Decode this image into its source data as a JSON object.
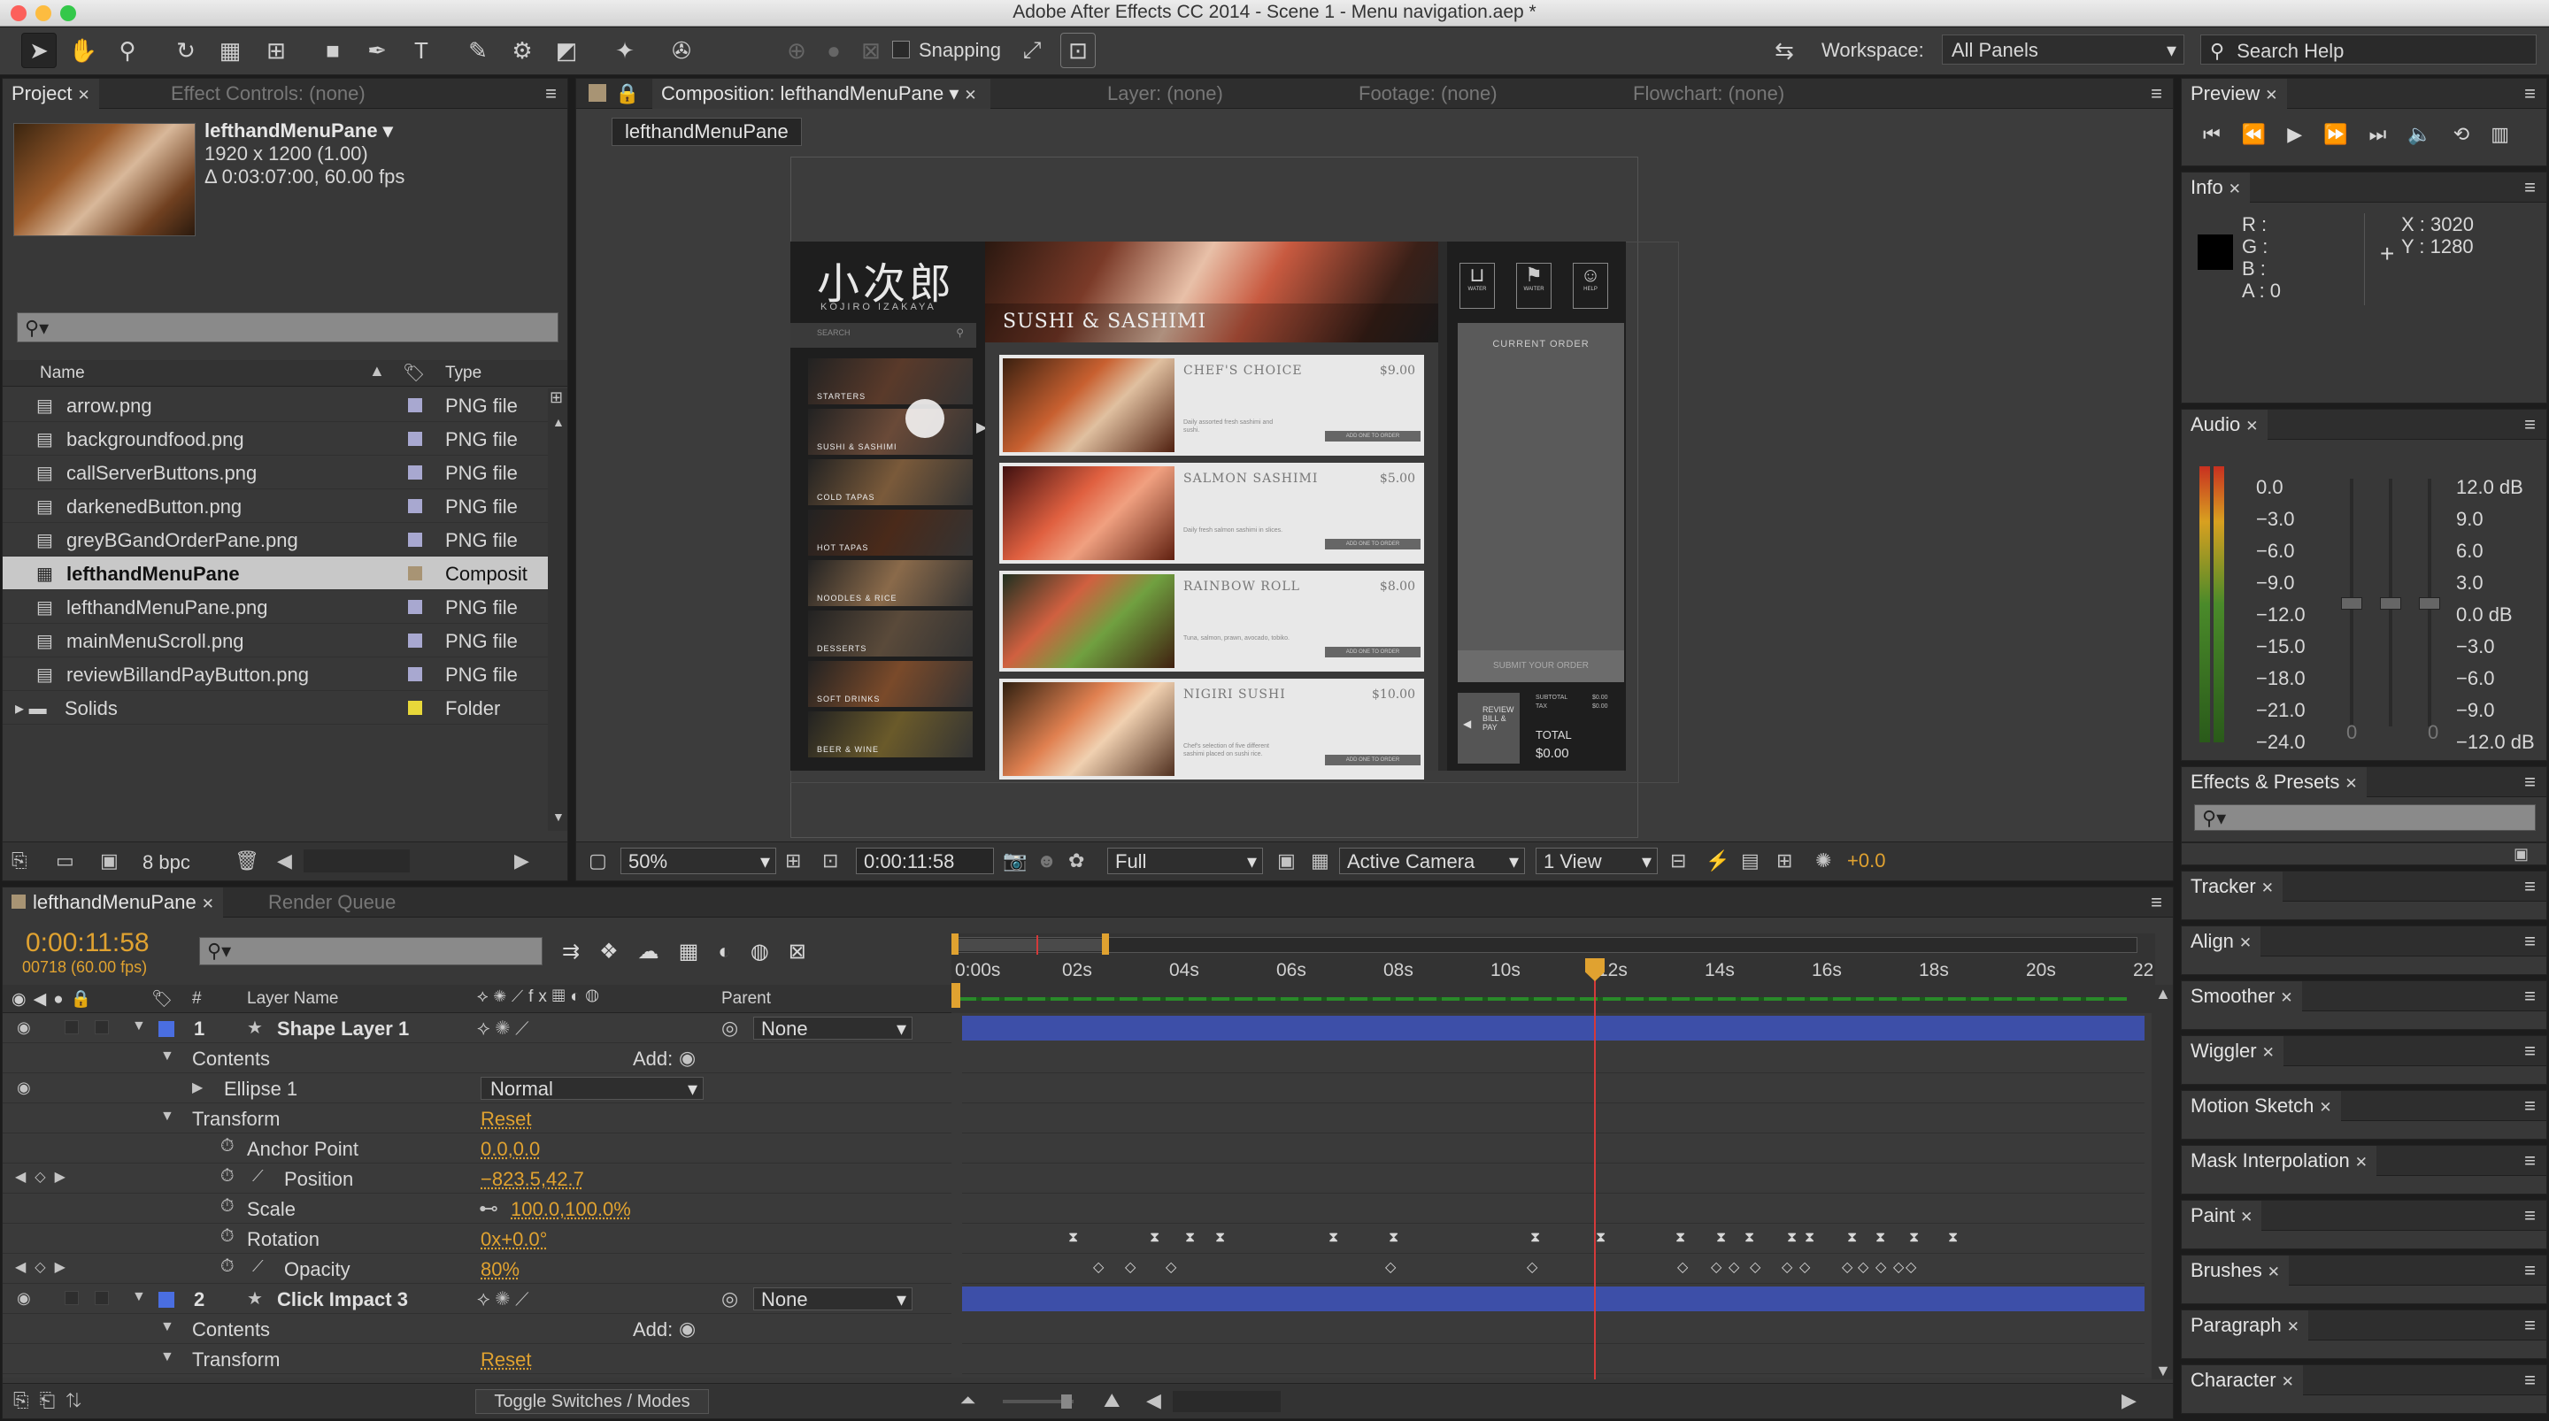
{
  "window": {
    "title": "Adobe After Effects CC 2014 - Scene 1 - Menu navigation.aep *"
  },
  "toolbar": {
    "snapping_label": "Snapping",
    "workspace_label": "Workspace:",
    "workspace_value": "All Panels",
    "search_help": "Search Help"
  },
  "project": {
    "tab": "Project",
    "effect_controls_tab": "Effect Controls: (none)",
    "item_name": "lefthandMenuPane",
    "item_size": "1920 x 1200 (1.00)",
    "item_duration": "Δ 0:03:07:00, 60.00 fps",
    "col_name": "Name",
    "col_type": "Type",
    "files": [
      {
        "name": "arrow.png",
        "type": "PNG file",
        "color": "#a8a8d0"
      },
      {
        "name": "backgroundfood.png",
        "type": "PNG file",
        "color": "#a8a8d0"
      },
      {
        "name": "callServerButtons.png",
        "type": "PNG file",
        "color": "#a8a8d0"
      },
      {
        "name": "darkenedButton.png",
        "type": "PNG file",
        "color": "#a8a8d0"
      },
      {
        "name": "greyBGandOrderPane.png",
        "type": "PNG file",
        "color": "#a8a8d0"
      },
      {
        "name": "lefthandMenuPane",
        "type": "Composit",
        "color": "#a89474"
      },
      {
        "name": "lefthandMenuPane.png",
        "type": "PNG file",
        "color": "#a8a8d0"
      },
      {
        "name": "mainMenuScroll.png",
        "type": "PNG file",
        "color": "#a8a8d0"
      },
      {
        "name": "reviewBillandPayButton.png",
        "type": "PNG file",
        "color": "#a8a8d0"
      },
      {
        "name": "Solids",
        "type": "Folder",
        "color": "#e8d83a"
      }
    ],
    "bpc": "8 bpc"
  },
  "composition": {
    "tab": "Composition: lefthandMenuPane",
    "other_tabs": [
      "Layer: (none)",
      "Footage: (none)",
      "Flowchart: (none)"
    ],
    "breadcrumb": "lefthandMenuPane",
    "zoom": "50%",
    "timecode": "0:00:11:58",
    "resolution": "Full",
    "camera": "Active Camera",
    "view": "1 View",
    "exposure": "+0.0"
  },
  "mock": {
    "logo": "小次郎",
    "logo_sub": "KOJIRO IZAKAYA",
    "search": "SEARCH",
    "header": "SUSHI & SASHIMI",
    "categories": [
      "STARTERS",
      "SUSHI & SASHIMI",
      "COLD TAPAS",
      "HOT TAPAS",
      "NOODLES & RICE",
      "DESSERTS",
      "SOFT DRINKS",
      "BEER & WINE"
    ],
    "items": [
      {
        "name": "CHEF'S CHOICE",
        "price": "$9.00",
        "desc": "Daily assorted fresh sashimi and sushi.",
        "btn": "ADD ONE TO ORDER"
      },
      {
        "name": "SALMON SASHIMI",
        "price": "$5.00",
        "desc": "Daily fresh salmon sashimi in slices.",
        "btn": "ADD ONE TO ORDER"
      },
      {
        "name": "RAINBOW ROLL",
        "price": "$8.00",
        "desc": "Tuna, salmon, prawn, avocado, tobiko.",
        "btn": "ADD ONE TO ORDER"
      },
      {
        "name": "NIGIRI SUSHI",
        "price": "$10.00",
        "desc": "Chef's selection of five different sashimi placed on sushi rice.",
        "btn": "ADD ONE TO ORDER"
      }
    ],
    "current_order": "CURRENT ORDER",
    "submit": "SUBMIT YOUR ORDER",
    "review": "REVIEW BILL & PAY",
    "subtotal": "SUBTOTAL",
    "tax": "TAX",
    "zero": "$0.00",
    "total": "TOTAL",
    "total_value": "$0.00",
    "icon_labels": [
      "WATER",
      "WAITER",
      "HELP"
    ]
  },
  "preview": {
    "tab": "Preview"
  },
  "info": {
    "tab": "Info",
    "r": "R :",
    "g": "G :",
    "b": "B :",
    "a": "A : 0",
    "x": "X : 3020",
    "y": "Y : 1280"
  },
  "audio": {
    "tab": "Audio",
    "left_scale": [
      "0.0",
      "−3.0",
      "−6.0",
      "−9.0",
      "−12.0",
      "−15.0",
      "−18.0",
      "−21.0",
      "−24.0"
    ],
    "right_scale": [
      "12.0 dB",
      "9.0",
      "6.0",
      "3.0",
      "0.0 dB",
      "−3.0",
      "−6.0",
      "−9.0",
      "−12.0 dB"
    ],
    "knob_left": "0",
    "knob_right": "0"
  },
  "right_panels": [
    "Effects & Presets",
    "Tracker",
    "Align",
    "Smoother",
    "Wiggler",
    "Motion Sketch",
    "Mask Interpolation",
    "Paint",
    "Brushes",
    "Paragraph",
    "Character"
  ],
  "timeline": {
    "tab": "lefthandMenuPane",
    "render_queue": "Render Queue",
    "timecode": "0:00:11:58",
    "frame_info": "00718 (60.00 fps)",
    "col_layer": "Layer Name",
    "col_parent": "Parent",
    "col_num": "#",
    "ruler": [
      "0:00s",
      "02s",
      "04s",
      "06s",
      "08s",
      "10s",
      "12s",
      "14s",
      "16s",
      "18s",
      "20s",
      "22"
    ],
    "rows": [
      {
        "num": "1",
        "name": "Shape Layer 1",
        "parent": "None"
      },
      {
        "label": "Contents",
        "extra": "Add:"
      },
      {
        "label": "Ellipse 1",
        "mode": "Normal"
      },
      {
        "label": "Transform",
        "value": "Reset"
      },
      {
        "label": "Anchor Point",
        "value": "0.0,0.0"
      },
      {
        "label": "Position",
        "value": "−823.5,42.7"
      },
      {
        "label": "Scale",
        "value": "100.0,100.0%"
      },
      {
        "label": "Rotation",
        "value": "0x+0.0°"
      },
      {
        "label": "Opacity",
        "value": "80%"
      },
      {
        "num": "2",
        "name": "Click Impact 3",
        "parent": "None"
      },
      {
        "label": "Contents",
        "extra": "Add:"
      },
      {
        "label": "Transform",
        "value": "Reset"
      }
    ],
    "toggle": "Toggle Switches / Modes"
  },
  "colors": {
    "accent": "#e0a230",
    "layer_bar": "#3d4fa8",
    "playhead": "#d43a3a",
    "label_blue": "#4a6ee0"
  }
}
